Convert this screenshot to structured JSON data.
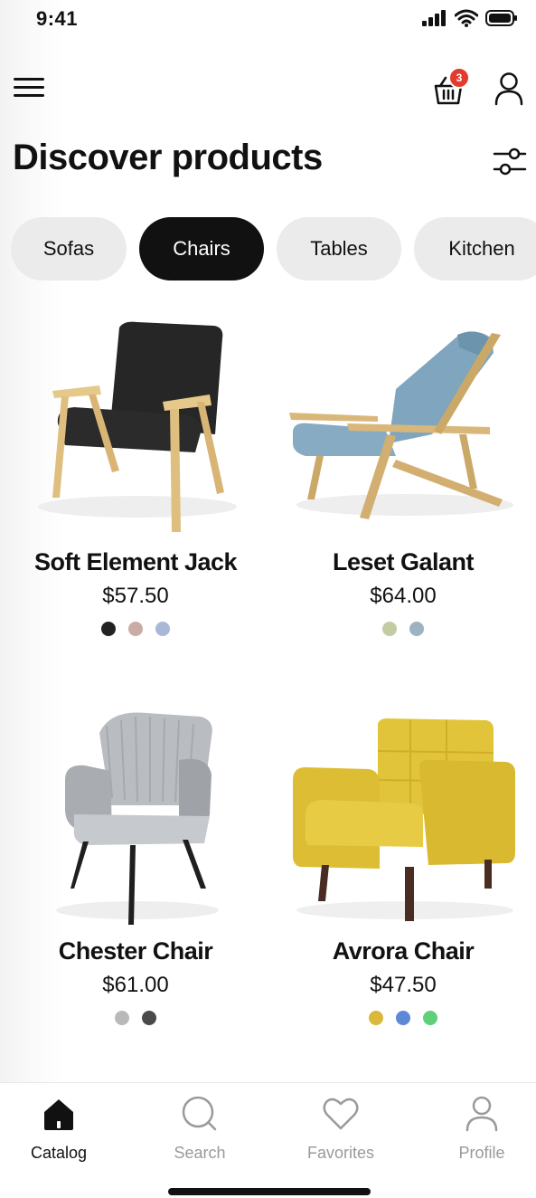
{
  "status_bar": {
    "time": "9:41"
  },
  "header": {
    "cart_count": "3",
    "title": "Discover products"
  },
  "categories": [
    {
      "label": "Sofas",
      "active": false
    },
    {
      "label": "Chairs",
      "active": true
    },
    {
      "label": "Tables",
      "active": false
    },
    {
      "label": "Kitchen",
      "active": false
    }
  ],
  "products": [
    {
      "name": "Soft Element Jack",
      "price": "$57.50",
      "colors": [
        "#222222",
        "#c9aca6",
        "#a9b8d6"
      ]
    },
    {
      "name": "Leset Galant",
      "price": "$64.00",
      "colors": [
        "#c3cba0",
        "#9db3c2"
      ]
    },
    {
      "name": "Chester Chair",
      "price": "$61.00",
      "colors": [
        "#b9b9b9",
        "#4a4a4a"
      ]
    },
    {
      "name": "Avrora Chair",
      "price": "$47.50",
      "colors": [
        "#d9b83a",
        "#5d88d6",
        "#5fcf79"
      ]
    }
  ],
  "nav": [
    {
      "label": "Catalog",
      "icon": "home-icon",
      "active": true
    },
    {
      "label": "Search",
      "icon": "search-icon",
      "active": false
    },
    {
      "label": "Favorites",
      "icon": "heart-icon",
      "active": false
    },
    {
      "label": "Profile",
      "icon": "user-icon",
      "active": false
    }
  ]
}
